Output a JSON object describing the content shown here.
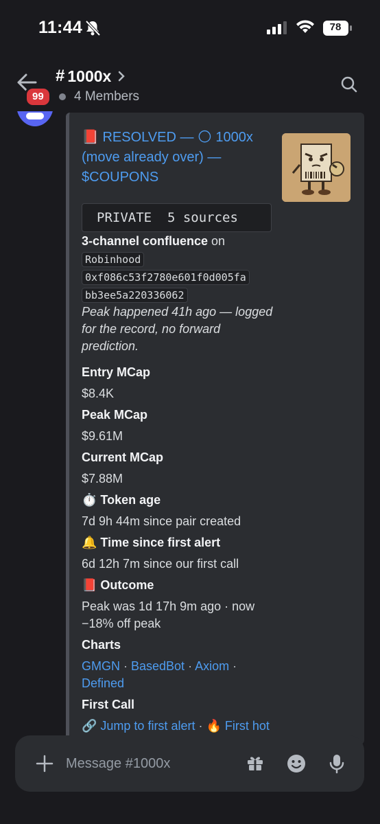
{
  "status": {
    "time": "11:44",
    "battery": "78"
  },
  "header": {
    "channel": "1000x",
    "unread_count": "99",
    "members": "4 Members"
  },
  "embed": {
    "title_emoji": "📕",
    "title_text": "RESOLVED — 🌕 1000x (move already over) — $COUPONS",
    "code_block": "PRIVATE  5 sources",
    "confluence_bold": "3-channel confluence",
    "confluence_on": " on",
    "chain": "Robinhood",
    "address_1": "0xf086c53f2780e601f0d005fa",
    "address_2": "bb3ee5a220336062",
    "note": "Peak happened 41h ago — logged for the record, no forward prediction.",
    "fields": [
      {
        "name": "Entry MCap",
        "value": "$8.4K"
      },
      {
        "name": "Peak MCap",
        "value": "$9.61M"
      },
      {
        "name": "Current MCap",
        "value": "$7.88M"
      },
      {
        "name": "⏱️ Token age",
        "value": "7d 9h 44m since pair created"
      },
      {
        "name": "🔔 Time since first alert",
        "value": "6d 12h 7m since our first call"
      },
      {
        "name": "📕 Outcome",
        "value": "Peak was 1d 17h 9m ago · now −18% off peak"
      }
    ],
    "charts_label": "Charts",
    "charts_links": [
      "GMGN",
      "BasedBot",
      "Axiom",
      "Defined"
    ],
    "first_call_label": "First Call",
    "first_call_link_1": "🔗 Jump to first alert",
    "first_call_link_2": "🔥 First hot CA"
  },
  "composer": {
    "placeholder": "Message #1000x"
  },
  "colors": {
    "accent_link": "#4e9cf0",
    "badge_red": "#da373c",
    "blurple": "#5865f2"
  }
}
